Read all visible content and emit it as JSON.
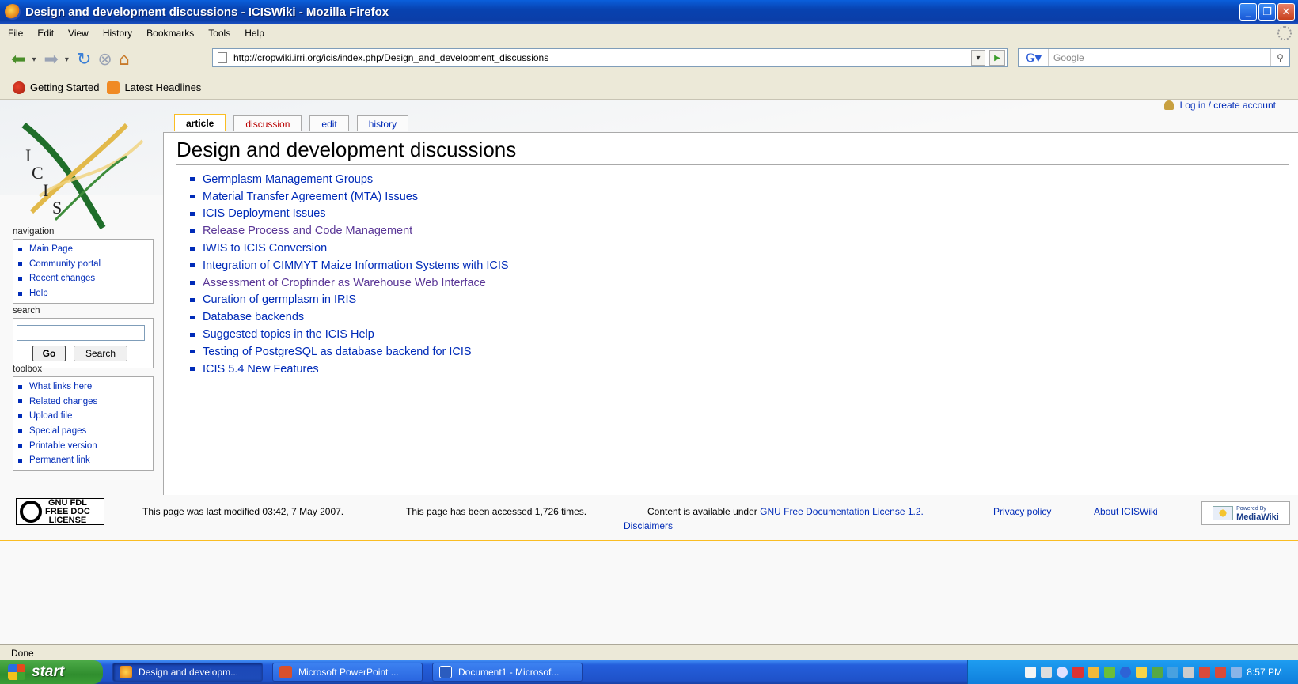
{
  "window": {
    "title": "Design and development discussions - ICISWiki - Mozilla Firefox"
  },
  "menubar": [
    "File",
    "Edit",
    "View",
    "History",
    "Bookmarks",
    "Tools",
    "Help"
  ],
  "navbar": {
    "url": "http://cropwiki.irri.org/icis/index.php/Design_and_development_discussions",
    "search_placeholder": "Google"
  },
  "bookmarks": [
    "Getting Started",
    "Latest Headlines"
  ],
  "wiki": {
    "login": "Log in / create account",
    "tabs": [
      "article",
      "discussion",
      "edit",
      "history"
    ],
    "title": "Design and development discussions",
    "articles": [
      "Germplasm Management Groups",
      "Material Transfer Agreement (MTA) Issues",
      "ICIS Deployment Issues",
      "Release Process and Code Management",
      "IWIS to ICIS Conversion",
      "Integration of CIMMYT Maize Information Systems with ICIS",
      "Assessment of Cropfinder as Warehouse Web Interface",
      "Curation of germplasm in IRIS",
      "Database backends",
      "Suggested topics in the ICIS Help",
      "Testing of PostgreSQL as database backend for ICIS",
      "ICIS 5.4 New Features"
    ],
    "logo_letters": [
      "I",
      "C",
      "I",
      "S"
    ],
    "navigation": {
      "heading": "navigation",
      "items": [
        "Main Page",
        "Community portal",
        "Recent changes",
        "Help"
      ]
    },
    "search": {
      "heading": "search",
      "go": "Go",
      "search": "Search"
    },
    "toolbox": {
      "heading": "toolbox",
      "items": [
        "What links here",
        "Related changes",
        "Upload file",
        "Special pages",
        "Printable version",
        "Permanent link"
      ]
    },
    "footer": {
      "gnu_badge": [
        "GNU FDL",
        "FREE DOC",
        "LICENSE"
      ],
      "modified": "This page was last modified 03:42, 7 May 2007.",
      "accessed": "This page has been accessed 1,726 times.",
      "license_prefix": "Content is available under",
      "license_link": "GNU Free Documentation License 1.2.",
      "disclaimers": "Disclaimers",
      "privacy": "Privacy policy",
      "about": "About ICISWiki",
      "powered_small": "Powered By",
      "powered": "MediaWiki"
    }
  },
  "statusbar": "Done",
  "taskbar": {
    "start": "start",
    "items": [
      "Design and developm...",
      "Microsoft PowerPoint ...",
      "Document1 - Microsof..."
    ],
    "clock": "8:57 PM"
  },
  "colors": {
    "link": "#002bb8",
    "visited": "#5a3696",
    "new_link": "#ba0000",
    "tab_selected_border": "#fabd23"
  }
}
